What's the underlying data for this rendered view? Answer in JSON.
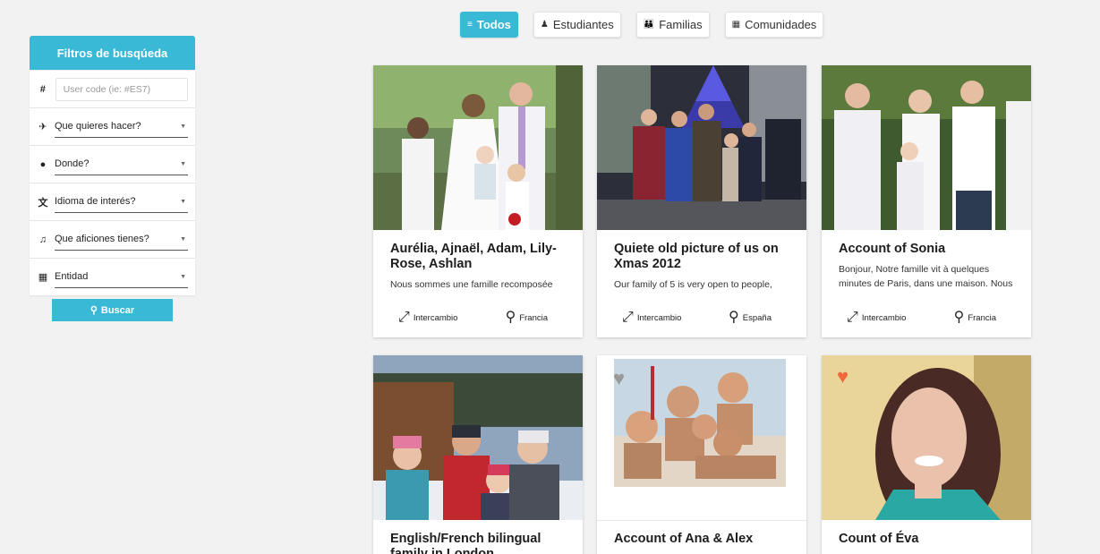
{
  "tabs": [
    {
      "label": "Todos",
      "icon": "list-icon",
      "glyph": "≡",
      "active": true
    },
    {
      "label": "Estudiantes",
      "icon": "person-icon",
      "glyph": "♟",
      "active": false
    },
    {
      "label": "Familias",
      "icon": "group-icon",
      "glyph": "👪",
      "active": false
    },
    {
      "label": "Comunidades",
      "icon": "building-icon",
      "glyph": "▦",
      "active": false
    }
  ],
  "sidebar": {
    "title": "Filtros de busqúeda",
    "code": {
      "glyph": "#",
      "placeholder": "User code (ie: #ES7)"
    },
    "filters": [
      {
        "label": "Que quieres hacer?",
        "icon": "plane-icon",
        "glyph": "✈"
      },
      {
        "label": "Donde?",
        "icon": "globe-icon",
        "glyph": "●"
      },
      {
        "label": "Idioma de interés?",
        "icon": "language-icon",
        "glyph": "文"
      },
      {
        "label": "Que aficiones tienes?",
        "icon": "music-icon",
        "glyph": "♫"
      },
      {
        "label": "Entidad",
        "icon": "building-icon",
        "glyph": "▦"
      }
    ],
    "caret": "▼",
    "search": {
      "label": "Buscar",
      "glyph": "⚲"
    }
  },
  "cards": [
    {
      "title": "Aurélia, Ajnaël, Adam, Lily-Rose, Ashlan",
      "desc": "Nous sommes une famille recomposée",
      "type": "Intercambio",
      "place": "Francia"
    },
    {
      "title": "Quiete old picture of us on Xmas 2012",
      "desc": "Our family of 5 is very open to people,",
      "type": "Intercambio",
      "place": "España"
    },
    {
      "title": "Account of Sonia",
      "desc": "Bonjour, Notre famille vit à quelques minutes de Paris, dans une maison. Nous",
      "type": "Intercambio",
      "place": "Francia"
    },
    {
      "title": "English/French bilingual family in London",
      "desc": "",
      "type": "",
      "place": ""
    },
    {
      "title": "Account of Ana & Alex",
      "desc": "",
      "type": "",
      "place": ""
    },
    {
      "title": "Count of Éva",
      "desc": "",
      "type": "",
      "place": ""
    }
  ],
  "icons": {
    "type_glyph": "⤢",
    "place_glyph": "⚲",
    "heart_glyph": "♥"
  },
  "colors": {
    "accent": "#3ab9d6",
    "heart_orange": "#f0683a",
    "heart_gray": "#999999"
  }
}
